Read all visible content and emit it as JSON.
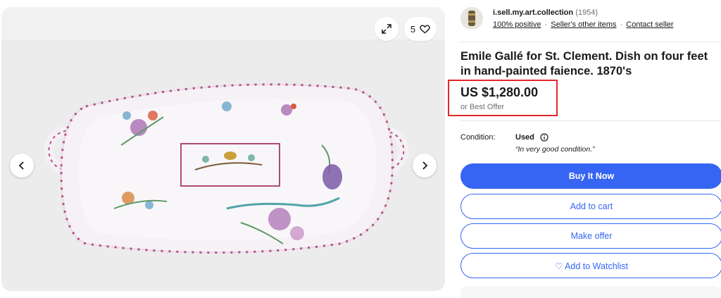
{
  "gallery": {
    "watch_count": "5",
    "icons": {
      "expand": "expand-icon",
      "heart": "heart-icon",
      "prev": "chevron-left-icon",
      "next": "chevron-right-icon"
    }
  },
  "seller": {
    "name": "i.sell.my.art.collection",
    "feedback_count": "(1954)",
    "positive": "100% positive",
    "sep": "·",
    "other_items": "Seller's other items",
    "contact": "Contact seller"
  },
  "item": {
    "title": "Emile Gallé for St. Clement. Dish on four feet in hand-painted faience. 1870's",
    "price": "US $1,280.00",
    "best_offer": "or Best Offer",
    "condition_label": "Condition:",
    "condition_value": "Used",
    "condition_note": "“In very good condition.”"
  },
  "actions": {
    "buy_now": "Buy It Now",
    "add_to_cart": "Add to cart",
    "make_offer": "Make offer",
    "watchlist": "♡ Add to Watchlist"
  },
  "colors": {
    "primary": "#3665f3",
    "highlight_box": "#e5262a",
    "text": "#191919",
    "muted": "#707070"
  }
}
